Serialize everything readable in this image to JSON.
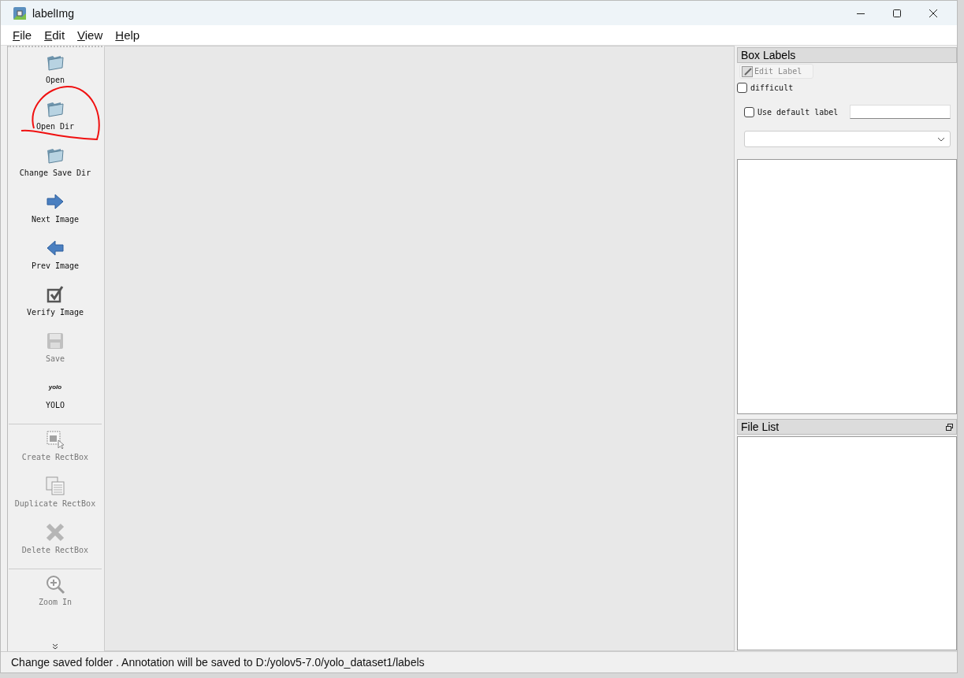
{
  "window": {
    "title": "labelImg"
  },
  "menu": [
    {
      "label": "File"
    },
    {
      "label": "Edit"
    },
    {
      "label": "View"
    },
    {
      "label": "Help"
    }
  ],
  "toolbar": [
    {
      "kind": "action",
      "label": "Open",
      "disabled": false
    },
    {
      "kind": "action",
      "label": "Open Dir",
      "disabled": false
    },
    {
      "kind": "action",
      "label": "Change Save Dir",
      "disabled": false
    },
    {
      "kind": "action",
      "label": "Next Image",
      "disabled": false
    },
    {
      "kind": "action",
      "label": "Prev Image",
      "disabled": false
    },
    {
      "kind": "action",
      "label": "Verify Image",
      "disabled": false
    },
    {
      "kind": "action",
      "label": "Save",
      "disabled": true
    },
    {
      "kind": "format",
      "label": "YOLO",
      "icon_text": "yolo",
      "disabled": false
    },
    {
      "kind": "separator"
    },
    {
      "kind": "action",
      "label": "Create RectBox",
      "disabled": true
    },
    {
      "kind": "action",
      "label": "Duplicate RectBox",
      "disabled": true
    },
    {
      "kind": "action",
      "label": "Delete RectBox",
      "disabled": true
    },
    {
      "kind": "separator"
    },
    {
      "kind": "action",
      "label": "Zoom In",
      "disabled": true
    }
  ],
  "box_labels": {
    "title": "Box Labels",
    "edit_button": {
      "label": "Edit Label",
      "disabled": true
    },
    "difficult": {
      "label": "difficult",
      "checked": false
    },
    "use_default": {
      "label": "Use default label",
      "checked": false
    }
  },
  "file_list": {
    "title": "File List"
  },
  "status_bar": "Change saved folder . Annotation will be saved to D:/yolov5-7.0/yolo_dataset1/labels"
}
